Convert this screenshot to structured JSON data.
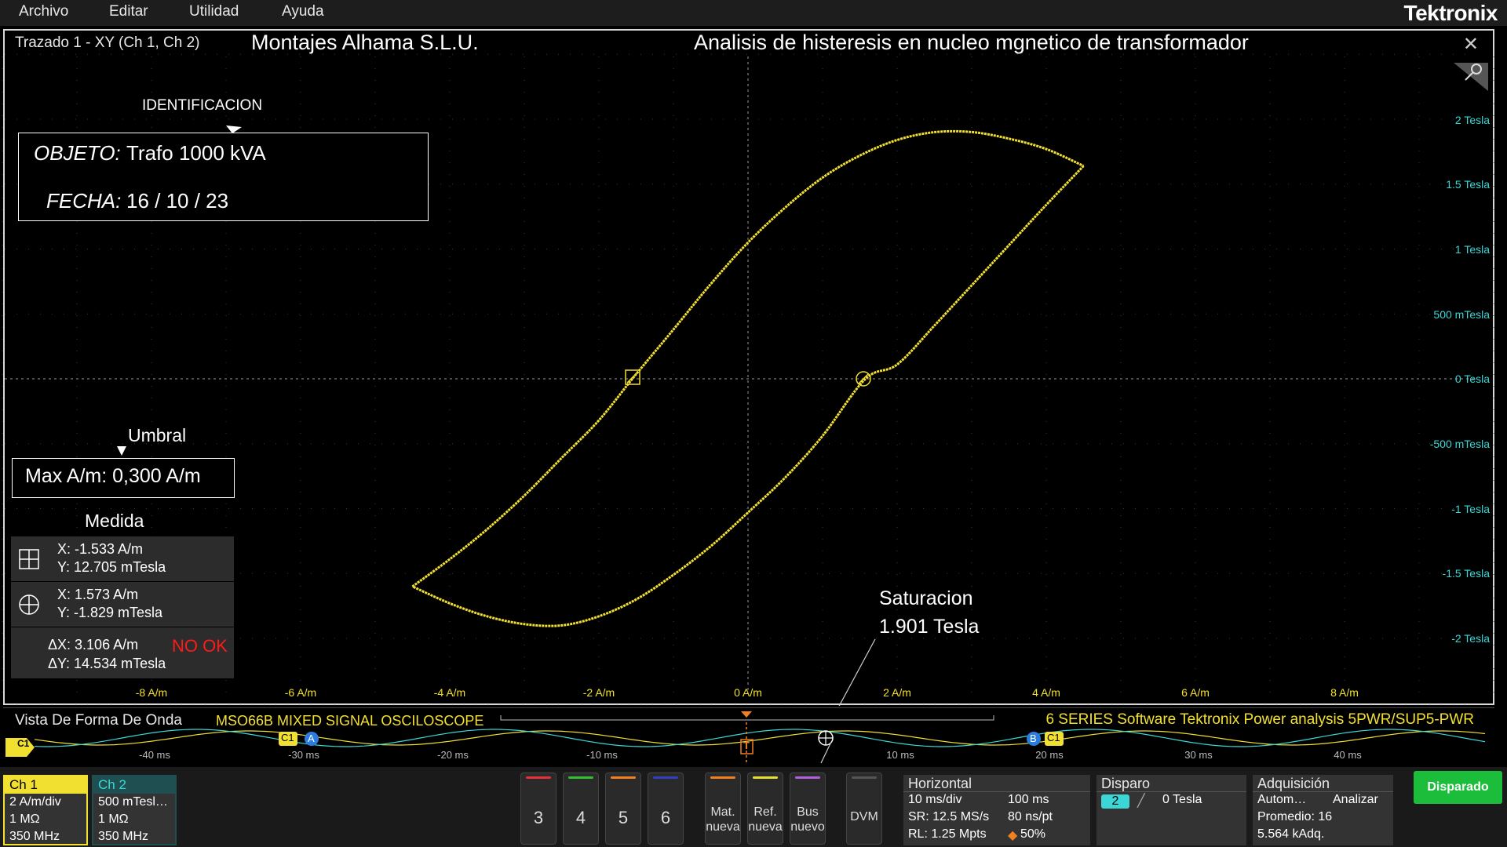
{
  "menu": {
    "items": [
      "Archivo",
      "Editar",
      "Utilidad",
      "Ayuda"
    ],
    "brand": "Tektronix"
  },
  "plot": {
    "label": "Trazado 1 - XY (Ch 1, Ch 2)",
    "company": "Montajes Alhama S.L.U.",
    "title": "Analisis de histeresis en nucleo mgnetico de transformador",
    "close": "✕",
    "trace_color": "#f2e030",
    "axis_color_y": "#3cd6d6"
  },
  "identification": {
    "heading": "IDENTIFICACION",
    "object_key": "OBJETO:",
    "object_value": "Trafo 1000 kVA",
    "date_key": "FECHA:",
    "date_value": "16 / 10 / 23"
  },
  "threshold": {
    "heading": "Umbral",
    "text": "Max A/m:  0,300 A/m"
  },
  "measurement": {
    "heading": "Medida",
    "cursor_a": {
      "x": "X:  -1.533 A/m",
      "y": "Y:   12.705 mTesla",
      "icon": "square-cursor-icon"
    },
    "cursor_b": {
      "x": "X:    1.573 A/m",
      "y": "Y:  -1.829 mTesla",
      "icon": "round-cursor-icon"
    },
    "delta": {
      "dx": "ΔX:   3.106 A/m",
      "dy": "ΔY:   14.534 mTesla",
      "status": "NO OK",
      "status_color": "#ff1a1a"
    }
  },
  "saturation": {
    "line1": "Saturacion",
    "line2": "1.901 Tesla"
  },
  "chart_data": {
    "type": "scatter",
    "x_unit": "A/m",
    "y_unit": "Tesla",
    "xlim": [
      -10,
      10
    ],
    "ylim": [
      -2.5,
      2.5
    ],
    "x_ticks": [
      "-8 A/m",
      "-6 A/m",
      "-4 A/m",
      "-2 A/m",
      "0 A/m",
      "2 A/m",
      "4 A/m",
      "6 A/m",
      "8 A/m"
    ],
    "y_ticks": [
      "2 Tesla",
      "1.5 Tesla",
      "1 Tesla",
      "500 mTesla",
      "0 Tesla",
      "-500 mTesla",
      "-1 Tesla",
      "-1.5 Tesla",
      "-2 Tesla"
    ],
    "series": [
      {
        "branch": "upper",
        "x": [
          -4.5,
          -4.0,
          -3.5,
          -3.0,
          -2.5,
          -2.0,
          -1.533,
          -1.0,
          -0.5,
          0.0,
          0.5,
          1.0,
          1.5,
          2.0,
          2.5,
          3.0,
          3.5,
          4.0,
          4.5
        ],
        "y": [
          -1.6,
          -1.39,
          -1.16,
          -0.9,
          -0.61,
          -0.32,
          0.0127,
          0.38,
          0.73,
          1.05,
          1.32,
          1.55,
          1.72,
          1.84,
          1.9,
          1.901,
          1.85,
          1.77,
          1.64
        ]
      },
      {
        "branch": "lower",
        "x": [
          4.5,
          4.0,
          3.5,
          3.0,
          2.5,
          2.0,
          1.573,
          1.0,
          0.5,
          0.0,
          -0.5,
          -1.0,
          -1.5,
          -2.0,
          -2.5,
          -3.0,
          -3.5,
          -4.0,
          -4.5
        ],
        "y": [
          1.64,
          1.34,
          1.03,
          0.72,
          0.41,
          0.11,
          -0.0018,
          -0.44,
          -0.76,
          -1.03,
          -1.29,
          -1.51,
          -1.7,
          -1.83,
          -1.9,
          -1.89,
          -1.83,
          -1.73,
          -1.6
        ]
      }
    ]
  },
  "waveform_view": {
    "title": "Vista De Forma De Onda",
    "model": "MSO66B MIXED SIGNAL OSCILOSCOPE",
    "software": "6 SERIES Software Tektronix Power analysis 5PWR/SUP5-PWR",
    "ticks": [
      "-40 ms",
      "-30 ms",
      "-20 ms",
      "-10 ms",
      "10 ms",
      "20 ms",
      "30 ms",
      "40 ms"
    ],
    "marker_c1": "C1",
    "marker_a": "A",
    "marker_b": "B",
    "trigger_marker": "T"
  },
  "channels": [
    {
      "name": "Ch 1",
      "scale": "2 A/m/div",
      "impedance": "1 MΩ",
      "bandwidth": "350 MHz",
      "color": "#f2e030"
    },
    {
      "name": "Ch 2",
      "scale": "500 mTesl…",
      "impedance": "1 MΩ",
      "bandwidth": "350 MHz",
      "color": "#3cd6d6"
    }
  ],
  "buttons": {
    "numbers": [
      {
        "label": "3",
        "color": "#e8303a"
      },
      {
        "label": "4",
        "color": "#30c030"
      },
      {
        "label": "5",
        "color": "#f08020"
      },
      {
        "label": "6",
        "color": "#3040c0"
      }
    ],
    "math": {
      "line1": "Mat.",
      "line2": "nueva",
      "color": "#f08020"
    },
    "ref": {
      "line1": "Ref.",
      "line2": "nueva",
      "color": "#e8e030"
    },
    "bus": {
      "line1": "Bus",
      "line2": "nuevo",
      "color": "#b060e0"
    },
    "dvm": "DVM"
  },
  "horizontal": {
    "heading": "Horizontal",
    "scale": "10 ms/div",
    "record_time": "100 ms",
    "sample_rate": "SR: 12.5 MS/s",
    "resolution": "80 ns/pt",
    "record_length": "RL: 1.25 Mpts",
    "position": "50%"
  },
  "trigger": {
    "heading": "Disparo",
    "source": "2",
    "level": "0 Tesla"
  },
  "acquisition": {
    "heading": "Adquisición",
    "mode": "Autom…",
    "action": "Analizar",
    "average": "Promedio: 16",
    "count": "5.564 kAdq."
  },
  "run_state": "Disparado"
}
